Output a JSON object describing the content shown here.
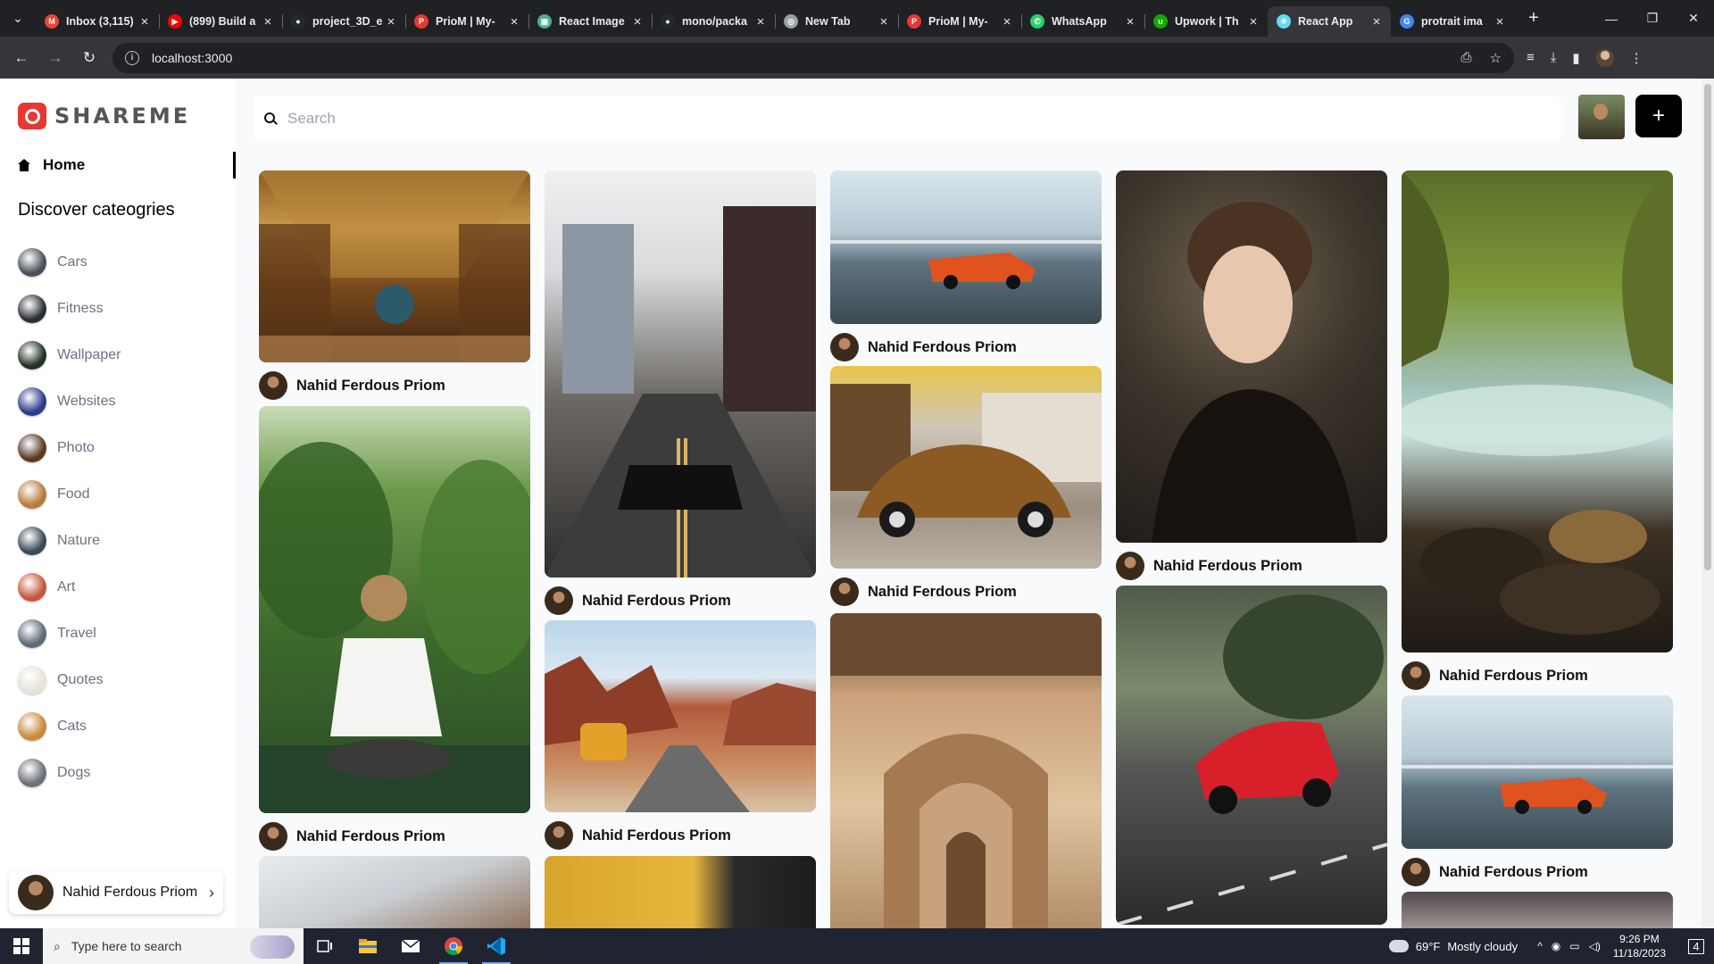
{
  "browser": {
    "tabs": [
      {
        "title": "Inbox (3,115)",
        "icon": "gmail-icon",
        "color": "#ea4335",
        "glyph": "M"
      },
      {
        "title": "(899) Build a",
        "icon": "youtube-icon",
        "color": "#ff0000",
        "glyph": "▶"
      },
      {
        "title": "project_3D_e",
        "icon": "github-icon",
        "color": "#24292f",
        "glyph": "●"
      },
      {
        "title": "PrioM | My-",
        "icon": "priom-icon",
        "color": "#e53935",
        "glyph": "P"
      },
      {
        "title": "React Image",
        "icon": "react-image-icon",
        "color": "#4caf9a",
        "glyph": "▣"
      },
      {
        "title": "mono/packa",
        "icon": "github-icon",
        "color": "#24292f",
        "glyph": "●"
      },
      {
        "title": "New Tab",
        "icon": "chrome-icon",
        "color": "#9aa0a6",
        "glyph": "◎"
      },
      {
        "title": "PrioM | My-",
        "icon": "priom-icon",
        "color": "#e53935",
        "glyph": "P"
      },
      {
        "title": "WhatsApp",
        "icon": "whatsapp-icon",
        "color": "#25d366",
        "glyph": "✆"
      },
      {
        "title": "Upwork | Th",
        "icon": "upwork-icon",
        "color": "#14a800",
        "glyph": "u"
      },
      {
        "title": "React App",
        "icon": "react-icon",
        "color": "#61dafb",
        "glyph": "⚛",
        "active": true
      },
      {
        "title": "protrait ima",
        "icon": "google-icon",
        "color": "#4285f4",
        "glyph": "G"
      }
    ],
    "url": "localhost:3000"
  },
  "app": {
    "logo_text": "SHAREME",
    "home_label": "Home",
    "categories_title": "Discover cateogries",
    "categories": [
      {
        "label": "Cars",
        "color": "#4a4f58"
      },
      {
        "label": "Fitness",
        "color": "#2b2f35"
      },
      {
        "label": "Wallpaper",
        "color": "#213226"
      },
      {
        "label": "Websites",
        "color": "#2d3a8a"
      },
      {
        "label": "Photo",
        "color": "#5a3a22"
      },
      {
        "label": "Food",
        "color": "#b97a3a"
      },
      {
        "label": "Nature",
        "color": "#3b4a57"
      },
      {
        "label": "Art",
        "color": "#c5563c"
      },
      {
        "label": "Travel",
        "color": "#5f6a78"
      },
      {
        "label": "Quotes",
        "color": "#e7e3d8"
      },
      {
        "label": "Cats",
        "color": "#c98a3b"
      },
      {
        "label": "Dogs",
        "color": "#6d7078"
      }
    ],
    "user_name": "Nahid Ferdous Priom",
    "search_placeholder": "Search",
    "add_label": "+",
    "pins": [
      {
        "author": "Nahid Ferdous Priom",
        "image": "library-hall",
        "shown": true
      },
      {
        "author": "Nahid Ferdous Priom",
        "image": "woman-white-dress-plants",
        "shown": true
      },
      {
        "author": "",
        "image": "building-partial",
        "shown": false
      },
      {
        "author": "Nahid Ferdous Priom",
        "image": "black-sports-car-road",
        "shown": true
      },
      {
        "author": "Nahid Ferdous Priom",
        "image": "desert-van",
        "shown": true
      },
      {
        "author": "",
        "image": "yellow-wall-partial",
        "shown": false
      },
      {
        "author": "Nahid Ferdous Priom",
        "image": "orange-sports-car-bridge",
        "shown": true
      },
      {
        "author": "Nahid Ferdous Priom",
        "image": "vintage-beetle",
        "shown": true
      },
      {
        "author": "",
        "image": "arched-corridor",
        "shown": false
      },
      {
        "author": "Nahid Ferdous Priom",
        "image": "woman-portrait",
        "shown": true
      },
      {
        "author": "",
        "image": "red-audi",
        "shown": false
      },
      {
        "author": "Nahid Ferdous Priom",
        "image": "forest-river",
        "shown": true
      },
      {
        "author": "Nahid Ferdous Priom",
        "image": "orange-sports-car-bridge",
        "shown": true
      },
      {
        "author": "",
        "image": "cloudy-partial",
        "shown": false
      }
    ]
  },
  "taskbar": {
    "search_placeholder": "Type here to search",
    "weather_temp": "69°F",
    "weather_text": "Mostly cloudy",
    "time": "9:26 PM",
    "date": "11/18/2023",
    "notifications": "4"
  }
}
